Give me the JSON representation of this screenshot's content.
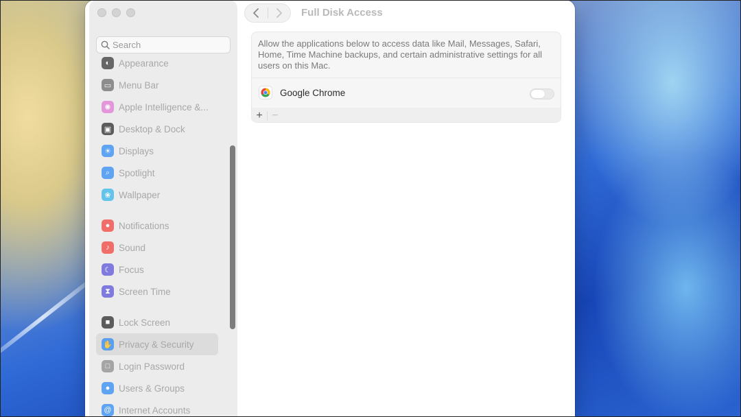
{
  "window": {
    "title": "Full Disk Access"
  },
  "sidebar": {
    "search_placeholder": "Search",
    "items": [
      {
        "label": "Appearance",
        "icon": "appearance-icon",
        "color": "#3a3a3a"
      },
      {
        "label": "Menu Bar",
        "icon": "menu-bar-icon",
        "color": "#6e6e6e"
      },
      {
        "label": "Apple Intelligence &...",
        "icon": "apple-intelligence-icon",
        "color": "#e27ad6"
      },
      {
        "label": "Desktop & Dock",
        "icon": "desktop-dock-icon",
        "color": "#2d2d2d"
      },
      {
        "label": "Displays",
        "icon": "displays-icon",
        "color": "#2f8df5"
      },
      {
        "label": "Spotlight",
        "icon": "spotlight-icon",
        "color": "#2f8df5"
      },
      {
        "label": "Wallpaper",
        "icon": "wallpaper-icon",
        "color": "#36b6e8"
      },
      {
        "label": "Notifications",
        "icon": "notifications-icon",
        "color": "#f0453f"
      },
      {
        "label": "Sound",
        "icon": "sound-icon",
        "color": "#f0453f"
      },
      {
        "label": "Focus",
        "icon": "focus-icon",
        "color": "#5b55d8"
      },
      {
        "label": "Screen Time",
        "icon": "screen-time-icon",
        "color": "#5b55d8"
      },
      {
        "label": "Lock Screen",
        "icon": "lock-screen-icon",
        "color": "#2d2d2d"
      },
      {
        "label": "Privacy & Security",
        "icon": "privacy-hand-icon",
        "color": "#2f8df5",
        "selected": true
      },
      {
        "label": "Login Password",
        "icon": "login-password-icon",
        "color": "#8e8e8e"
      },
      {
        "label": "Users & Groups",
        "icon": "users-groups-icon",
        "color": "#2f8df5"
      },
      {
        "label": "Internet Accounts",
        "icon": "internet-accounts-icon",
        "color": "#2f8df5"
      }
    ]
  },
  "content": {
    "description": "Allow the applications below to access data like Mail, Messages, Safari, Home, Time Machine backups, and certain administrative settings for all users on this Mac.",
    "apps": [
      {
        "name": "Google Chrome",
        "icon": "chrome-icon",
        "enabled": false
      }
    ],
    "add_label": "+",
    "remove_label": "−"
  },
  "annotation": {
    "arrow_color": "#f03a2e"
  }
}
